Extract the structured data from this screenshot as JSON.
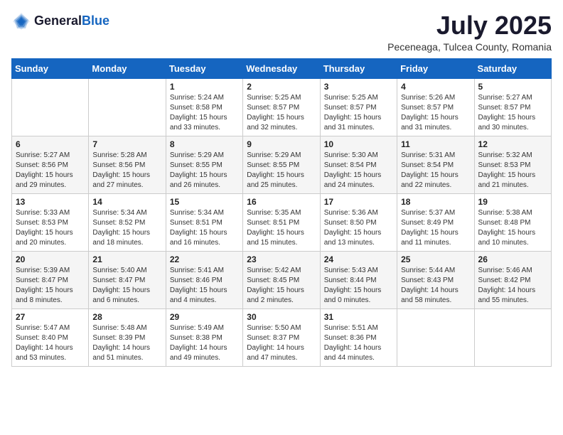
{
  "logo": {
    "general": "General",
    "blue": "Blue"
  },
  "title": "July 2025",
  "location": "Peceneaga, Tulcea County, Romania",
  "days_of_week": [
    "Sunday",
    "Monday",
    "Tuesday",
    "Wednesday",
    "Thursday",
    "Friday",
    "Saturday"
  ],
  "weeks": [
    [
      {
        "day": "",
        "info": ""
      },
      {
        "day": "",
        "info": ""
      },
      {
        "day": "1",
        "info": "Sunrise: 5:24 AM\nSunset: 8:58 PM\nDaylight: 15 hours and 33 minutes."
      },
      {
        "day": "2",
        "info": "Sunrise: 5:25 AM\nSunset: 8:57 PM\nDaylight: 15 hours and 32 minutes."
      },
      {
        "day": "3",
        "info": "Sunrise: 5:25 AM\nSunset: 8:57 PM\nDaylight: 15 hours and 31 minutes."
      },
      {
        "day": "4",
        "info": "Sunrise: 5:26 AM\nSunset: 8:57 PM\nDaylight: 15 hours and 31 minutes."
      },
      {
        "day": "5",
        "info": "Sunrise: 5:27 AM\nSunset: 8:57 PM\nDaylight: 15 hours and 30 minutes."
      }
    ],
    [
      {
        "day": "6",
        "info": "Sunrise: 5:27 AM\nSunset: 8:56 PM\nDaylight: 15 hours and 29 minutes."
      },
      {
        "day": "7",
        "info": "Sunrise: 5:28 AM\nSunset: 8:56 PM\nDaylight: 15 hours and 27 minutes."
      },
      {
        "day": "8",
        "info": "Sunrise: 5:29 AM\nSunset: 8:55 PM\nDaylight: 15 hours and 26 minutes."
      },
      {
        "day": "9",
        "info": "Sunrise: 5:29 AM\nSunset: 8:55 PM\nDaylight: 15 hours and 25 minutes."
      },
      {
        "day": "10",
        "info": "Sunrise: 5:30 AM\nSunset: 8:54 PM\nDaylight: 15 hours and 24 minutes."
      },
      {
        "day": "11",
        "info": "Sunrise: 5:31 AM\nSunset: 8:54 PM\nDaylight: 15 hours and 22 minutes."
      },
      {
        "day": "12",
        "info": "Sunrise: 5:32 AM\nSunset: 8:53 PM\nDaylight: 15 hours and 21 minutes."
      }
    ],
    [
      {
        "day": "13",
        "info": "Sunrise: 5:33 AM\nSunset: 8:53 PM\nDaylight: 15 hours and 20 minutes."
      },
      {
        "day": "14",
        "info": "Sunrise: 5:34 AM\nSunset: 8:52 PM\nDaylight: 15 hours and 18 minutes."
      },
      {
        "day": "15",
        "info": "Sunrise: 5:34 AM\nSunset: 8:51 PM\nDaylight: 15 hours and 16 minutes."
      },
      {
        "day": "16",
        "info": "Sunrise: 5:35 AM\nSunset: 8:51 PM\nDaylight: 15 hours and 15 minutes."
      },
      {
        "day": "17",
        "info": "Sunrise: 5:36 AM\nSunset: 8:50 PM\nDaylight: 15 hours and 13 minutes."
      },
      {
        "day": "18",
        "info": "Sunrise: 5:37 AM\nSunset: 8:49 PM\nDaylight: 15 hours and 11 minutes."
      },
      {
        "day": "19",
        "info": "Sunrise: 5:38 AM\nSunset: 8:48 PM\nDaylight: 15 hours and 10 minutes."
      }
    ],
    [
      {
        "day": "20",
        "info": "Sunrise: 5:39 AM\nSunset: 8:47 PM\nDaylight: 15 hours and 8 minutes."
      },
      {
        "day": "21",
        "info": "Sunrise: 5:40 AM\nSunset: 8:47 PM\nDaylight: 15 hours and 6 minutes."
      },
      {
        "day": "22",
        "info": "Sunrise: 5:41 AM\nSunset: 8:46 PM\nDaylight: 15 hours and 4 minutes."
      },
      {
        "day": "23",
        "info": "Sunrise: 5:42 AM\nSunset: 8:45 PM\nDaylight: 15 hours and 2 minutes."
      },
      {
        "day": "24",
        "info": "Sunrise: 5:43 AM\nSunset: 8:44 PM\nDaylight: 15 hours and 0 minutes."
      },
      {
        "day": "25",
        "info": "Sunrise: 5:44 AM\nSunset: 8:43 PM\nDaylight: 14 hours and 58 minutes."
      },
      {
        "day": "26",
        "info": "Sunrise: 5:46 AM\nSunset: 8:42 PM\nDaylight: 14 hours and 55 minutes."
      }
    ],
    [
      {
        "day": "27",
        "info": "Sunrise: 5:47 AM\nSunset: 8:40 PM\nDaylight: 14 hours and 53 minutes."
      },
      {
        "day": "28",
        "info": "Sunrise: 5:48 AM\nSunset: 8:39 PM\nDaylight: 14 hours and 51 minutes."
      },
      {
        "day": "29",
        "info": "Sunrise: 5:49 AM\nSunset: 8:38 PM\nDaylight: 14 hours and 49 minutes."
      },
      {
        "day": "30",
        "info": "Sunrise: 5:50 AM\nSunset: 8:37 PM\nDaylight: 14 hours and 47 minutes."
      },
      {
        "day": "31",
        "info": "Sunrise: 5:51 AM\nSunset: 8:36 PM\nDaylight: 14 hours and 44 minutes."
      },
      {
        "day": "",
        "info": ""
      },
      {
        "day": "",
        "info": ""
      }
    ]
  ]
}
